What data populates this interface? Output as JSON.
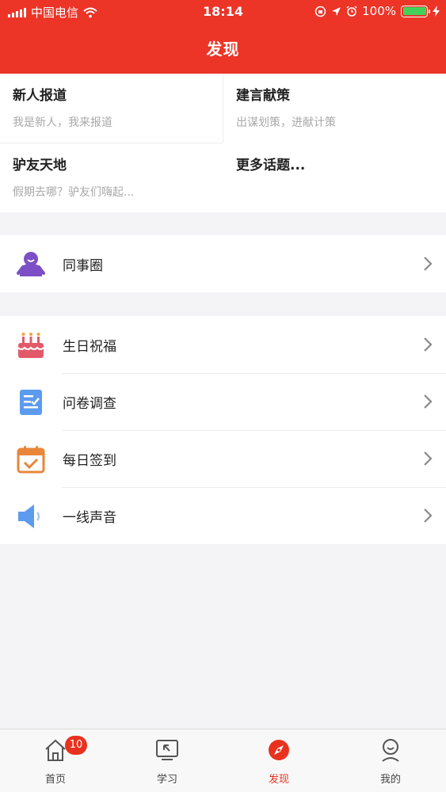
{
  "status_bar": {
    "carrier": "中国电信",
    "time": "18:14",
    "battery": "100%"
  },
  "header": {
    "title": "发现"
  },
  "topics": [
    {
      "title": "新人报道",
      "subtitle": "我是新人，我来报道"
    },
    {
      "title": "建言献策",
      "subtitle": "出谋划策，进献计策"
    },
    {
      "title": "驴友天地",
      "subtitle": "假期去哪？驴友们嗨起..."
    },
    {
      "title": "更多话题...",
      "subtitle": ""
    }
  ],
  "group1": [
    {
      "label": "同事圈",
      "icon": "colleague-circle-icon"
    }
  ],
  "group2": [
    {
      "label": "生日祝福",
      "icon": "birthday-cake-icon"
    },
    {
      "label": "问卷调查",
      "icon": "survey-icon"
    },
    {
      "label": "每日签到",
      "icon": "calendar-checkin-icon"
    },
    {
      "label": "一线声音",
      "icon": "speaker-icon"
    }
  ],
  "tabbar": {
    "tabs": [
      {
        "label": "首页",
        "icon": "home-icon",
        "badge": "10"
      },
      {
        "label": "学习",
        "icon": "study-icon"
      },
      {
        "label": "发现",
        "icon": "discover-icon",
        "active": true
      },
      {
        "label": "我的",
        "icon": "profile-icon"
      }
    ]
  },
  "colors": {
    "primary": "#ec3427",
    "background": "#f4f4f6",
    "battery": "#43d15a"
  }
}
